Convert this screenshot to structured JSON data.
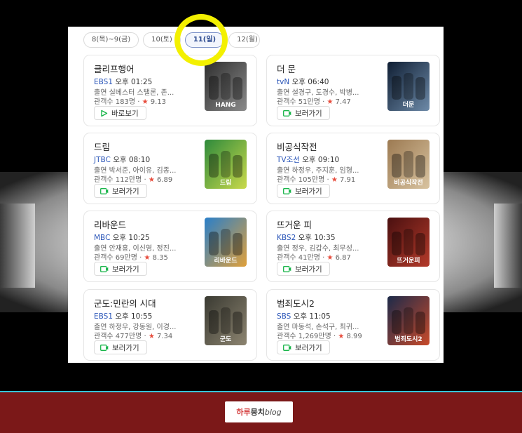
{
  "date_tabs": [
    {
      "label": "8(목)~9(금)",
      "active": false
    },
    {
      "label": "10(토)",
      "active": false
    },
    {
      "label": "11(일)",
      "active": true
    },
    {
      "label": "12(월)",
      "active": false
    }
  ],
  "highlight_color": "#f3f000",
  "link_color": "#2a55b8",
  "programs": [
    {
      "title": "클리프행어",
      "channel": "EBS1",
      "time": "오후 01:25",
      "cast": "출연  실베스터 스탤론, 존...",
      "audience": "관객수  183명",
      "rating": "9.13",
      "button": "바로보기",
      "button_icon": "play-icon",
      "poster_text": "HANG",
      "poster_colors": [
        "#2f2f2f",
        "#8a8a8a"
      ]
    },
    {
      "title": "더 문",
      "channel": "tvN",
      "time": "오후 06:40",
      "cast": "출연  설경구, 도경수, 박병...",
      "audience": "관객수  51만명",
      "rating": "7.47",
      "button": "보러가기",
      "button_icon": "tv-icon",
      "poster_text": "더문",
      "poster_colors": [
        "#0f1e33",
        "#6d8aa8"
      ]
    },
    {
      "title": "드림",
      "channel": "JTBC",
      "time": "오후 08:10",
      "cast": "출연  박서준, 아이유, 김종...",
      "audience": "관객수  112만명",
      "rating": "6.89",
      "button": "보러가기",
      "button_icon": "tv-icon",
      "poster_text": "드림",
      "poster_colors": [
        "#2e8a3c",
        "#c9d94a"
      ]
    },
    {
      "title": "비공식작전",
      "channel": "TV조선",
      "time": "오후 09:10",
      "cast": "출연  하정우, 주지훈, 임형...",
      "audience": "관객수  105만명",
      "rating": "7.91",
      "button": "보러가기",
      "button_icon": "tv-icon",
      "poster_text": "비공식작전",
      "poster_colors": [
        "#9c7a52",
        "#d8c3a0"
      ]
    },
    {
      "title": "리바운드",
      "channel": "MBC",
      "time": "오후 10:25",
      "cast": "출연  안재홍, 이신영, 정진...",
      "audience": "관객수  69만명",
      "rating": "8.35",
      "button": "보러가기",
      "button_icon": "tv-icon",
      "poster_text": "리바운드",
      "poster_colors": [
        "#2a7fc9",
        "#e0a03a"
      ]
    },
    {
      "title": "뜨거운 피",
      "channel": "KBS2",
      "time": "오후 10:35",
      "cast": "출연  정우, 김갑수, 최무성...",
      "audience": "관객수  41만명",
      "rating": "6.87",
      "button": "보러가기",
      "button_icon": "tv-icon",
      "poster_text": "뜨거운피",
      "poster_colors": [
        "#4a1010",
        "#b43a2a"
      ]
    },
    {
      "title": "군도:민란의 시대",
      "channel": "EBS1",
      "time": "오후 10:55",
      "cast": "출연  하정우, 강동원, 이경...",
      "audience": "관객수  477만명",
      "rating": "7.34",
      "button": "보러가기",
      "button_icon": "tv-icon",
      "poster_text": "군도",
      "poster_colors": [
        "#3a3a32",
        "#8c8470"
      ]
    },
    {
      "title": "범죄도시2",
      "channel": "SBS",
      "time": "오후 11:05",
      "cast": "출연  마동석, 손석구, 최귀...",
      "audience": "관객수  1,269만명",
      "rating": "8.99",
      "button": "보러가기",
      "button_icon": "tv-icon",
      "poster_text": "범죄도시2",
      "poster_colors": [
        "#1c2a4a",
        "#c84a2a"
      ]
    }
  ],
  "footer": {
    "logo_part1": "하루",
    "logo_part2": "뭉치",
    "logo_part3": "blog"
  }
}
